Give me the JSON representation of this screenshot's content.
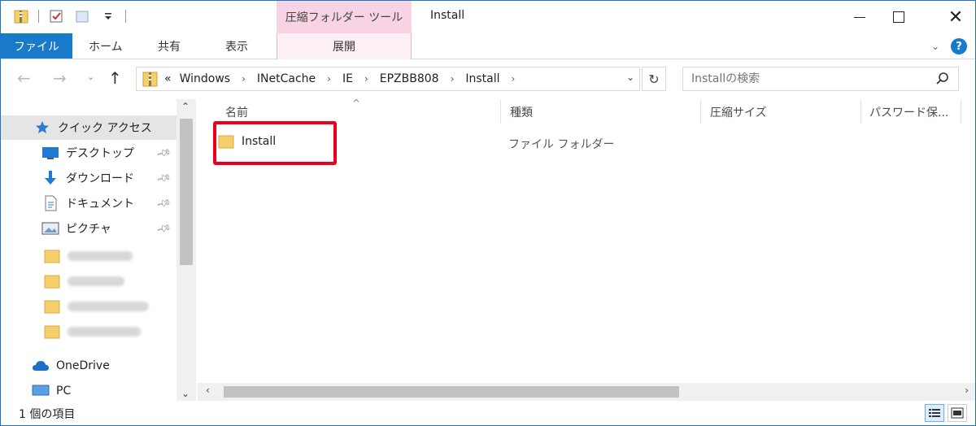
{
  "window": {
    "title": "Install",
    "context_tab_group": "圧縮フォルダー ツール",
    "close_glyph": "✕"
  },
  "ribbon": {
    "tabs": [
      "ファイル",
      "ホーム",
      "共有",
      "表示"
    ],
    "context_tab": "展開"
  },
  "address": {
    "prefix": "«",
    "breadcrumbs": [
      "Windows",
      "INetCache",
      "IE",
      "EPZBB808",
      "Install"
    ],
    "separator": "›"
  },
  "search": {
    "placeholder": "Installの検索"
  },
  "nav_pane": {
    "quick_access": "クイック アクセス",
    "items": [
      {
        "label": "デスクトップ",
        "icon": "desktop-icon",
        "pinned": true
      },
      {
        "label": "ダウンロード",
        "icon": "download-icon",
        "pinned": true
      },
      {
        "label": "ドキュメント",
        "icon": "document-icon",
        "pinned": true
      },
      {
        "label": "ピクチャ",
        "icon": "picture-icon",
        "pinned": true
      }
    ],
    "blurred_folder_count": 4,
    "onedrive": "OneDrive",
    "pc": "PC"
  },
  "columns": [
    "名前",
    "種類",
    "圧縮サイズ",
    "パスワード保..."
  ],
  "files": [
    {
      "name": "Install",
      "type": "ファイル フォルダー"
    }
  ],
  "status": {
    "item_count": "1 個の項目"
  },
  "colors": {
    "accent": "#1979ca",
    "context_tab": "#f7d3e3",
    "highlight": "#e8001c",
    "folder": "#f5cf6b"
  }
}
